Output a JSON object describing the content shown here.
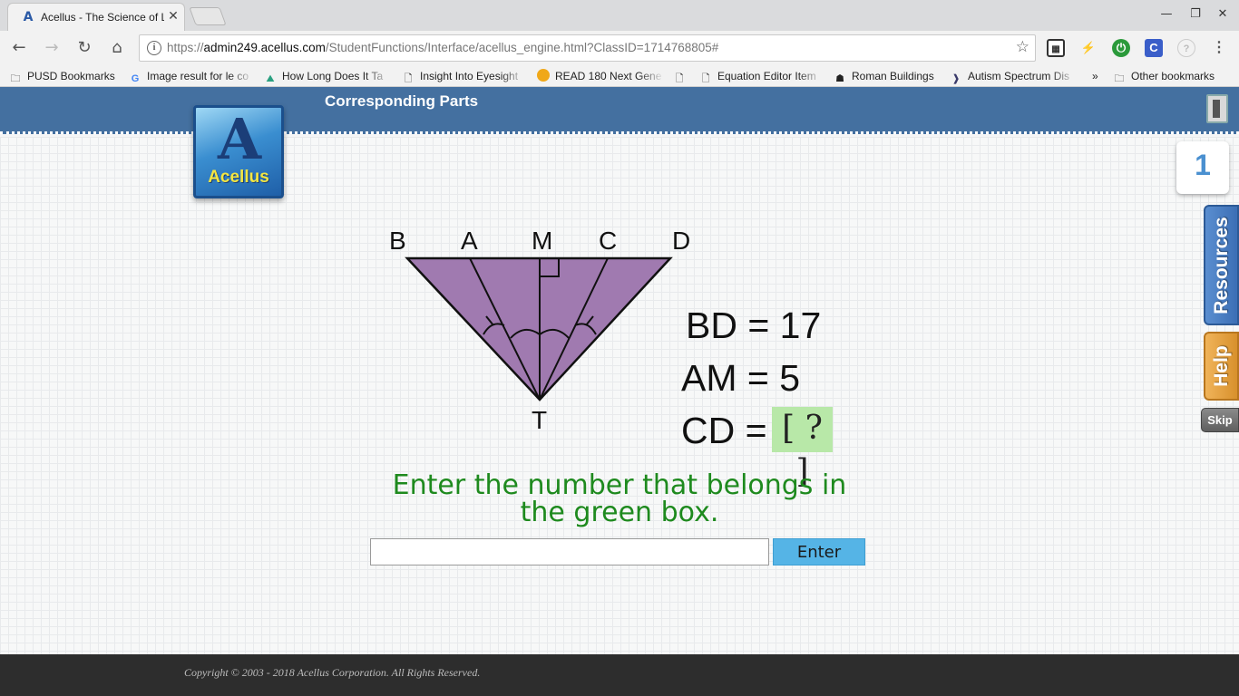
{
  "browser": {
    "tab_title": "Acellus - The Science of Learning",
    "tab_favicon": "acellus-icon",
    "url_prefix": "https://",
    "url_host": "admin249.acellus.com",
    "url_path": "/StudentFunctions/Interface/acellus_engine.html?ClassID=1714768805#",
    "bookmarks": [
      {
        "label": "PUSD Bookmarks",
        "icon": "folder-icon"
      },
      {
        "label": "Image result for le co",
        "icon": "google-icon"
      },
      {
        "label": "How Long Does It Ta",
        "icon": "page-icon"
      },
      {
        "label": "Insight Into Eyesight",
        "icon": "page-icon"
      },
      {
        "label": "READ 180 Next Gene",
        "icon": "circle-icon"
      },
      {
        "label": "",
        "icon": "page-icon"
      },
      {
        "label": "Equation Editor Item",
        "icon": "page-icon"
      },
      {
        "label": "Roman Buildings",
        "icon": "helmet-icon"
      },
      {
        "label": "Autism Spectrum Dis",
        "icon": "arrow-icon"
      },
      {
        "label": "»",
        "icon": ""
      },
      {
        "label": "Other bookmarks",
        "icon": "folder-icon"
      }
    ]
  },
  "header": {
    "lesson_title": "Corresponding Parts"
  },
  "logo": {
    "text": "Acellus"
  },
  "side": {
    "counter": "1",
    "resources": "Resources",
    "help": "Help",
    "skip": "Skip"
  },
  "diagram": {
    "labels": {
      "b": "B",
      "a": "A",
      "m": "M",
      "c": "C",
      "d": "D",
      "t": "T"
    },
    "fill_color": "#a07ab0"
  },
  "problem": {
    "eq1": "BD = 17",
    "eq2": "AM = 5",
    "eq3_prefix": "CD =",
    "green_box": "[ ? ]",
    "instruction_line1": "Enter the number that belongs in",
    "instruction_line2": "the green box."
  },
  "answer": {
    "value": "",
    "enter_label": "Enter"
  },
  "footer": {
    "copyright": "Copyright © 2003 - 2018 Acellus Corporation.  All Rights Reserved."
  }
}
